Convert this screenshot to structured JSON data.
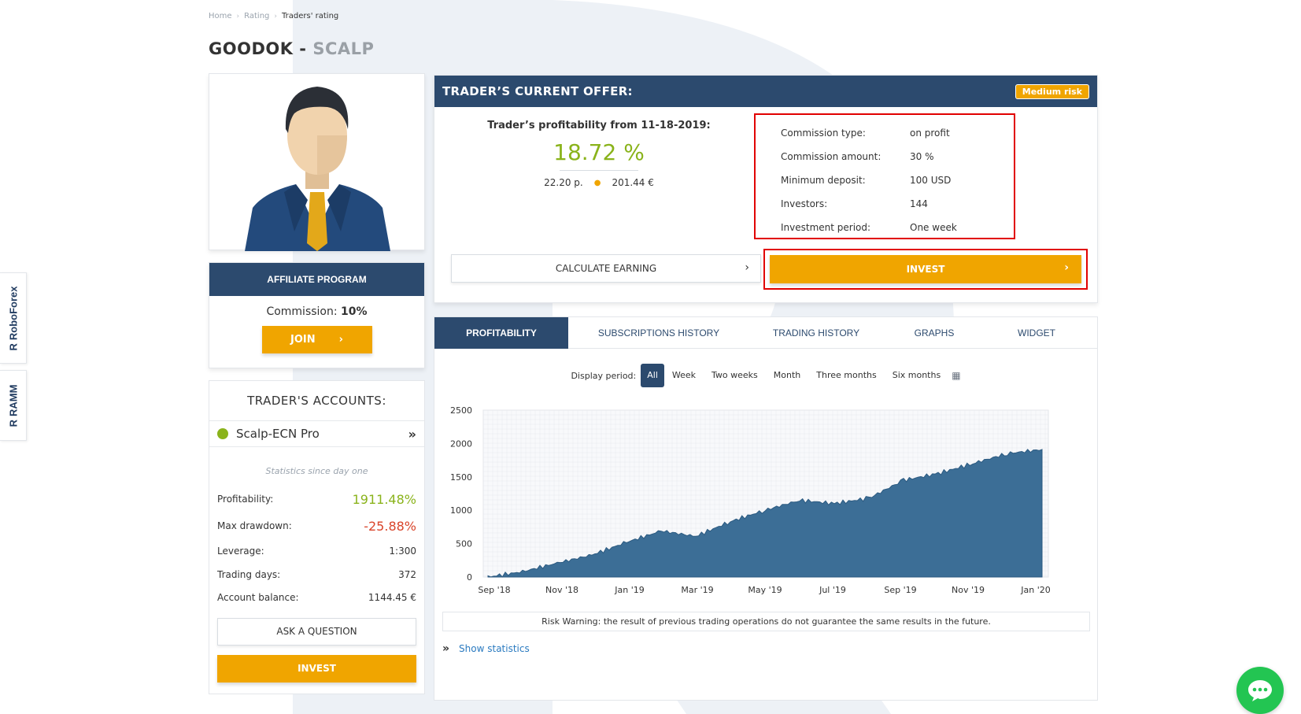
{
  "breadcrumb": {
    "home": "Home",
    "rating": "Rating",
    "current": "Traders' rating"
  },
  "title": {
    "name": "GOODOK",
    "separator": " - ",
    "strategy": "SCALP"
  },
  "side_tabs": {
    "roboforex": "RoboForex",
    "ramm": "RAMM"
  },
  "affiliate": {
    "heading": "AFFILIATE PROGRAM",
    "commission_label": "Commission: ",
    "commission_value": "10%",
    "join_label": "JOIN"
  },
  "accounts": {
    "heading": "TRADER'S ACCOUNTS:",
    "account_name": "Scalp-ECN Pro",
    "stats_caption": "Statistics since day one",
    "stats": [
      {
        "label": "Profitability:",
        "value": "1911.48%"
      },
      {
        "label": "Max drawdown:",
        "value": "-25.88%"
      },
      {
        "label": "Leverage:",
        "value": "1:300"
      },
      {
        "label": "Trading days:",
        "value": "372"
      },
      {
        "label": "Account balance:",
        "value": "1144.45 €"
      }
    ],
    "ask_label": "ASK A QUESTION",
    "invest_label": "INVEST"
  },
  "offer": {
    "heading": "TRADER’S CURRENT OFFER:",
    "risk_badge": "Medium risk",
    "profitability_label": "Trader’s profitability from 11-18-2019:",
    "profitability_value": "18.72 %",
    "sub_value_1": "22.20 р.",
    "sub_value_2": "201.44 €",
    "terms": [
      {
        "label": "Commission type:",
        "value": "on profit"
      },
      {
        "label": "Commission amount:",
        "value": "30 %"
      },
      {
        "label": "Minimum deposit:",
        "value": "100 USD"
      },
      {
        "label": "Investors:",
        "value": "144"
      },
      {
        "label": "Investment period:",
        "value": "One week"
      }
    ],
    "calc_label": "CALCULATE EARNING",
    "invest_label": "INVEST",
    "accent": "#f0a500",
    "navy": "#2c4a6e",
    "highlight": "#e10000"
  },
  "tabs": [
    "PROFITABILITY",
    "SUBSCRIPTIONS HISTORY",
    "TRADING HISTORY",
    "GRAPHS",
    "WIDGET"
  ],
  "period": {
    "label": "Display period:",
    "options": [
      "All",
      "Week",
      "Two weeks",
      "Month",
      "Three months",
      "Six months"
    ],
    "selected": "All"
  },
  "chart_data": {
    "type": "area",
    "title": "",
    "xlabel": "",
    "ylabel": "",
    "ylim": [
      0,
      2500
    ],
    "yticks": [
      "2500",
      "2000",
      "1500",
      "1000",
      "500",
      "0"
    ],
    "xticks": [
      "Sep '18",
      "Nov '18",
      "Jan '19",
      "Mar '19",
      "May '19",
      "Jul '19",
      "Sep '19",
      "Nov '19",
      "Jan '20"
    ],
    "x": [
      "Sep '18",
      "Oct '18",
      "Nov '18",
      "Dec '18",
      "Jan '19",
      "Feb '19",
      "Mar '19",
      "Apr '19",
      "May '19",
      "Jun '19",
      "Jul '19",
      "Aug '19",
      "Sep '19",
      "Oct '19",
      "Nov '19",
      "Dec '19",
      "Jan '20"
    ],
    "values": [
      0,
      80,
      210,
      330,
      520,
      690,
      610,
      830,
      1000,
      1150,
      1100,
      1180,
      1450,
      1550,
      1700,
      1850,
      1910
    ],
    "color": "#3c6e96",
    "grid": true
  },
  "risk_warning": "Risk Warning: the result of previous trading operations do not guarantee the same results in the future.",
  "show_statistics": "Show statistics"
}
